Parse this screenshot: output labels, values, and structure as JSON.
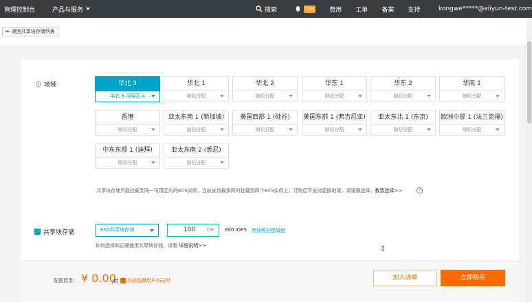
{
  "topbar": {
    "brand": "管理控制台",
    "products": "产品与服务",
    "search": "搜索",
    "notification_count": "7/9",
    "links": [
      "费用",
      "工单",
      "备案",
      "支持"
    ],
    "user": "kongwe*****@aliyun-test.com"
  },
  "back_button": "返回共享块存储列表",
  "region": {
    "label": "地域",
    "cards": [
      {
        "name": "华北 3",
        "zone": "华北 3 可用区 A",
        "selected": true
      },
      {
        "name": "华北 1",
        "zone": "随机分配"
      },
      {
        "name": "华北 2",
        "zone": "随机分配"
      },
      {
        "name": "华东 1",
        "zone": "随机分配"
      },
      {
        "name": "华东 2",
        "zone": "随机分配"
      },
      {
        "name": "华南 1",
        "zone": "随机分配"
      },
      {
        "name": "香港",
        "zone": "随机分配"
      },
      {
        "name": "亚太东南 1 (新加坡)",
        "zone": "随机分配"
      },
      {
        "name": "美国西部 1 (硅谷)",
        "zone": "随机分配"
      },
      {
        "name": "美国东部 1 (弗吉尼亚)",
        "zone": "随机分配"
      },
      {
        "name": "亚太东北 1 (东京)",
        "zone": "随机分配"
      },
      {
        "name": "欧洲中部 1 (法兰克福)",
        "zone": "随机分配"
      },
      {
        "name": "中东东部 1 (迪拜)",
        "zone": "随机分配"
      },
      {
        "name": "亚太东南 2 (悉尼)",
        "zone": "随机分配"
      }
    ],
    "note": "共享块存储只能挂载到同一可用区内的ECS实例，当前支持最多同时挂载到四个ECS实例上，订购后不支持更换地域，请谨慎选择，",
    "note_link": "教我选择>>"
  },
  "storage": {
    "label": "共享块存储",
    "disk_type": "SSD共享块存储",
    "size": "100",
    "unit": "GB",
    "iops": "800 IOPS",
    "snapshot_link": "用快照创建磁盘",
    "howto": "如何选择和正确使用共享块存储，请看",
    "howto_link": "详细说明>>"
  },
  "footer": {
    "fee_label": "配置费用：",
    "fee_value": "¥ 0.00",
    "fee_unit": "/时",
    "promo": "内部结算用户0元/时",
    "add_to_cart": "加入清单",
    "buy_now": "立即购买"
  },
  "colors": {
    "accent": "#00a2ca",
    "orange": "#ff6a00",
    "topbar": "#373d41"
  }
}
